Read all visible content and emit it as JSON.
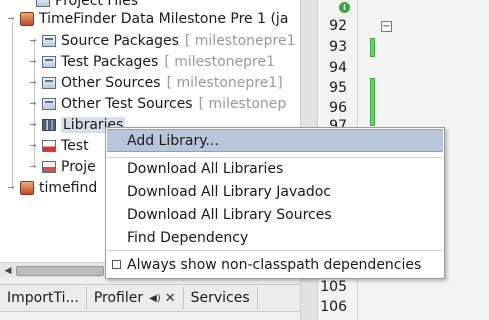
{
  "tree": {
    "items": [
      {
        "label": "Project Files",
        "ctx": "",
        "icon": "folder-icon"
      },
      {
        "label": "TimeFinder Data Milestone Pre 1 (ja",
        "ctx": "",
        "icon": "coffee-cup-icon"
      },
      {
        "label": "Source Packages",
        "ctx": "[ milestonepre1",
        "icon": "package-icon"
      },
      {
        "label": "Test Packages",
        "ctx": "[ milestonepre1",
        "icon": "package-icon"
      },
      {
        "label": "Other Sources",
        "ctx": "[ milestonepre1]",
        "icon": "package-icon"
      },
      {
        "label": "Other Test Sources",
        "ctx": "[ milestonep",
        "icon": "package-icon"
      },
      {
        "label": "Libraries",
        "ctx": "",
        "icon": "library-icon"
      },
      {
        "label": "Test",
        "ctx": "",
        "icon": "test-library-icon"
      },
      {
        "label": "Proje",
        "ctx": "",
        "icon": "project-files-icon"
      },
      {
        "label": "timefind",
        "ctx": "",
        "icon": "coffee-cup-icon"
      }
    ]
  },
  "tabs": [
    {
      "label": "ImportTi..."
    },
    {
      "label": "Profiler"
    },
    {
      "label": "Services"
    }
  ],
  "gutter": {
    "line_numbers": [
      "92",
      "93",
      "94",
      "95",
      "96",
      "97",
      "105",
      "106"
    ]
  },
  "menu": {
    "items": [
      {
        "label": "Add Library..."
      },
      {
        "label": "Download All Libraries"
      },
      {
        "label": "Download All Library Javadoc"
      },
      {
        "label": "Download All Library Sources"
      },
      {
        "label": "Find Dependency"
      },
      {
        "label": "Always show non-classpath dependencies"
      }
    ]
  },
  "colors": {
    "menu_hover": "#b7c6da",
    "change_bar": "#66d466",
    "selection": "#d7dfea"
  }
}
